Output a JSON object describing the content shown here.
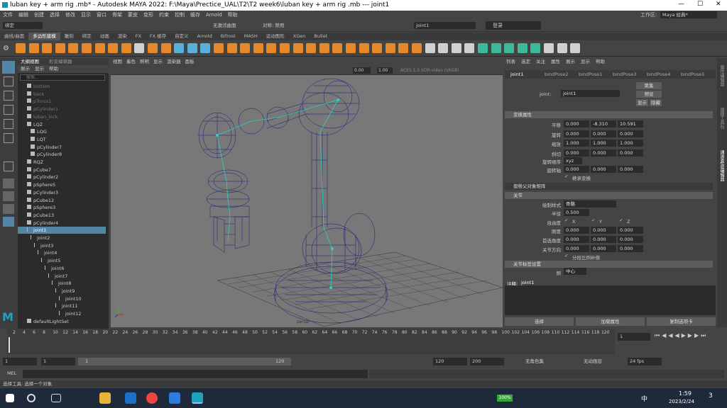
{
  "window": {
    "title": "luban key + arm rig .mb* - Autodesk MAYA 2022: F:\\Maya\\Prectice_UAL\\T2\\T2 week6\\luban key + arm rig .mb  ---  joint1",
    "min": "—",
    "max": "☐",
    "close": "✕"
  },
  "menubar": [
    "文件",
    "编辑",
    "创建",
    "选择",
    "修改",
    "显示",
    "窗口",
    "骨架",
    "蒙皮",
    "变形",
    "约束",
    "控制",
    "缓存",
    "Arnold",
    "帮助"
  ],
  "workspace": {
    "label": "工作区:",
    "value": "Maya 经典*"
  },
  "status": {
    "mode": "绑定",
    "live_surface": "无激活曲面",
    "symmetry": "对称: 禁用",
    "joint_field": "joint1",
    "login": "登录"
  },
  "shelf_tabs": [
    "曲线/曲面",
    "多边形建模",
    "雕刻",
    "绑定",
    "动画",
    "渲染",
    "FX",
    "FX 缓存",
    "自定义",
    "Arnold",
    "Bifrost",
    "MASH",
    "运动图形",
    "XGen",
    "Bullet"
  ],
  "shelf_active": "多边形建模",
  "outliner": {
    "tabs": [
      "大纲视图",
      "形变编辑器"
    ],
    "menu": [
      "展示",
      "显示",
      "帮助"
    ],
    "search_placeholder": "搜索...",
    "items": [
      {
        "name": "bottom",
        "indent": 1,
        "dim": true
      },
      {
        "name": "back",
        "indent": 1,
        "dim": true
      },
      {
        "name": "pTorus1",
        "indent": 1,
        "dim": true
      },
      {
        "name": "pCylinder1",
        "indent": 1,
        "dim": true
      },
      {
        "name": "luban_lock",
        "indent": 1,
        "dim": true
      },
      {
        "name": "LQZ",
        "indent": 1
      },
      {
        "name": "LQG",
        "indent": 2
      },
      {
        "name": "LQT",
        "indent": 2
      },
      {
        "name": "pCylinder7",
        "indent": 2
      },
      {
        "name": "pCylinder8",
        "indent": 2
      },
      {
        "name": "RQZ",
        "indent": 1
      },
      {
        "name": "pCube7",
        "indent": 1
      },
      {
        "name": "pCylinder2",
        "indent": 1
      },
      {
        "name": "pSphere5",
        "indent": 1
      },
      {
        "name": "pCylinder3",
        "indent": 1
      },
      {
        "name": "pCube12",
        "indent": 1
      },
      {
        "name": "pSphere3",
        "indent": 1
      },
      {
        "name": "pCube13",
        "indent": 1
      },
      {
        "name": "pCylinder4",
        "indent": 1
      },
      {
        "name": "joint1",
        "indent": 1,
        "selected": true
      },
      {
        "name": "joint2",
        "indent": 2
      },
      {
        "name": "joint3",
        "indent": 3
      },
      {
        "name": "joint4",
        "indent": 4
      },
      {
        "name": "joint5",
        "indent": 5
      },
      {
        "name": "joint6",
        "indent": 6
      },
      {
        "name": "joint7",
        "indent": 7
      },
      {
        "name": "joint8",
        "indent": 8
      },
      {
        "name": "joint9",
        "indent": 9
      },
      {
        "name": "joint10",
        "indent": 10
      },
      {
        "name": "joint11",
        "indent": 9
      },
      {
        "name": "joint12",
        "indent": 10
      },
      {
        "name": "defaultLightSet",
        "indent": 1
      }
    ]
  },
  "viewport": {
    "menu": [
      "视图",
      "着色",
      "照明",
      "显示",
      "渲染器",
      "面板"
    ],
    "exposure": "0.00",
    "gamma": "1.00",
    "colorspace": "ACES 1.0 SDR-video (sRGB)",
    "camera": "persp"
  },
  "attribute_editor": {
    "menu": [
      "列表",
      "选定",
      "关注",
      "属性",
      "展示",
      "显示",
      "帮助"
    ],
    "tabs": [
      "joint1",
      "bindPose2",
      "bindPose1",
      "bindPose3",
      "bindPose4",
      "bindPose5"
    ],
    "joint_label": "joint:",
    "joint_value": "joint1",
    "focus_btn": "聚集",
    "preset_btn": "预设",
    "show_btn": "显示",
    "hide_btn": "隐藏",
    "transform_section": "变换属性",
    "rows": [
      {
        "label": "平移",
        "values": [
          "0.000",
          "-8.310",
          "10.591"
        ]
      },
      {
        "label": "旋转",
        "values": [
          "0.000",
          "0.000",
          "0.000"
        ]
      },
      {
        "label": "缩放",
        "values": [
          "1.000",
          "1.000",
          "1.000"
        ]
      },
      {
        "label": "斜切",
        "values": [
          "0.000",
          "0.000",
          "0.000"
        ]
      }
    ],
    "rotate_order_label": "旋转顺序",
    "rotate_order": "xyz",
    "rotate_axis_label": "旋转轴",
    "rotate_axis": [
      "0.000",
      "0.000",
      "0.000"
    ],
    "inherit_label": "继承变换",
    "pivots_section": "假移父对象矩阵",
    "joint_section": "关节",
    "draw_style_label": "绘制样式",
    "draw_style": "骨骼",
    "radius_label": "半径",
    "radius": "0.500",
    "dof_label": "自由度",
    "dof": [
      "X",
      "Y",
      "Z"
    ],
    "stiffness_label": "刚度",
    "stiffness": [
      "0.000",
      "0.000",
      "0.000"
    ],
    "pref_angle_label": "首选角度",
    "pref_angle": [
      "0.000",
      "0.000",
      "0.000"
    ],
    "joint_orient_label": "关节方向",
    "joint_orient": [
      "0.000",
      "0.000",
      "0.000"
    ],
    "segment_scale_label": "分段比例补偿",
    "label_section": "关节标签设置",
    "side_label": "侧",
    "side": "中心",
    "notes_label": "注释:",
    "notes_value": "joint1",
    "bottom_btns": [
      "选择",
      "加载属性",
      "复制选项卡"
    ]
  },
  "right_side_tabs": [
    "属性编辑器",
    "建模工具包",
    "通道盒/层编辑器"
  ],
  "timeline": {
    "ticks": [
      "2",
      "4",
      "6",
      "8",
      "10",
      "12",
      "14",
      "16",
      "18",
      "20",
      "22",
      "24",
      "26",
      "28",
      "30",
      "32",
      "34",
      "36",
      "38",
      "40",
      "42",
      "44",
      "46",
      "48",
      "50",
      "52",
      "54",
      "56",
      "58",
      "60",
      "62",
      "64",
      "66",
      "68",
      "70",
      "72",
      "74",
      "76",
      "78",
      "80",
      "82",
      "84",
      "86",
      "88",
      "90",
      "92",
      "94",
      "96",
      "98",
      "100",
      "102",
      "104",
      "106",
      "108",
      "110",
      "112",
      "114",
      "116",
      "118",
      "120"
    ],
    "current": "1"
  },
  "range": {
    "start": "1",
    "start2": "1",
    "range_field": "1",
    "range_end": "120",
    "end": "120",
    "end2": "200",
    "char_set": "无角色集",
    "anim_layer": "无动画层",
    "fps": "24 fps"
  },
  "cmdline": {
    "lang": "MEL"
  },
  "helpline": "选择工具: 选择一个对象",
  "taskbar": {
    "battery": "100%",
    "ime": "中",
    "time": "1:59",
    "date": "2023/2/24",
    "notif": "3"
  }
}
